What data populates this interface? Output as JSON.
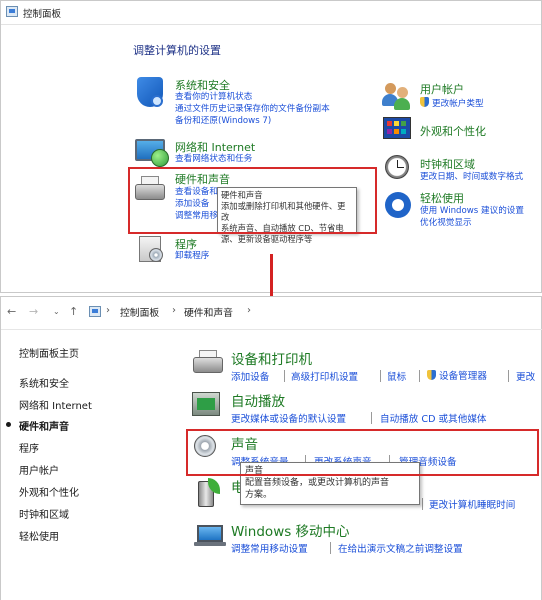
{
  "top": {
    "address": "控制面板",
    "adjust_title": "调整计算机的设置",
    "categories": {
      "security": {
        "title": "系统和安全",
        "links": [
          "查看你的计算机状态",
          "通过文件历史记录保存你的文件备份副本",
          "备份和还原(Windows 7)"
        ]
      },
      "network": {
        "title": "网络和 Internet",
        "links": [
          "查看网络状态和任务"
        ]
      },
      "hardware": {
        "title": "硬件和声音",
        "links": [
          "查看设备和",
          "添加设备",
          "调整常用移"
        ]
      },
      "programs": {
        "title": "程序",
        "links": [
          "卸载程序"
        ]
      },
      "accounts": {
        "title": "用户帐户",
        "links": [
          "更改帐户类型"
        ]
      },
      "appearance": {
        "title": "外观和个性化",
        "links": []
      },
      "clock": {
        "title": "时钟和区域",
        "links": [
          "更改日期、时间或数字格式"
        ]
      },
      "ease": {
        "title": "轻松使用",
        "links": [
          "使用 Windows 建议的设置",
          "优化视觉显示"
        ]
      }
    },
    "tooltip": {
      "title": "硬件和声音",
      "lines": [
        "添加或删除打印机和其他硬件、更改",
        "系统声音、自动播放 CD、节省电",
        "源、更新设备驱动程序等"
      ]
    }
  },
  "bottom": {
    "breadcrumb": [
      "控制面板",
      "硬件和声音"
    ],
    "sidebar": [
      {
        "label": "控制面板主页",
        "active": false
      },
      {
        "label": "系统和安全",
        "active": false
      },
      {
        "label": "网络和 Internet",
        "active": false
      },
      {
        "label": "硬件和声音",
        "active": true
      },
      {
        "label": "程序",
        "active": false
      },
      {
        "label": "用户帐户",
        "active": false
      },
      {
        "label": "外观和个性化",
        "active": false
      },
      {
        "label": "时钟和区域",
        "active": false
      },
      {
        "label": "轻松使用",
        "active": false
      }
    ],
    "sections": {
      "devices": {
        "title": "设备和打印机",
        "links": [
          "添加设备",
          "高级打印机设置",
          "鼠标",
          "设备管理器",
          "更改"
        ]
      },
      "autoplay": {
        "title": "自动播放",
        "links": [
          "更改媒体或设备的默认设置",
          "自动播放 CD 或其他媒体"
        ]
      },
      "sound": {
        "title": "声音",
        "links": [
          "调整系统音量",
          "更改系统声音",
          "管理音频设备"
        ]
      },
      "power": {
        "title": "电",
        "links": [
          "更改计算机睡眠时间"
        ]
      },
      "mobility": {
        "title": "Windows 移动中心",
        "links": [
          "调整常用移动设置",
          "在给出演示文稿之前调整设置"
        ]
      }
    },
    "tooltip": {
      "title": "声音",
      "lines": [
        "配置音频设备，或更改计算机的声音",
        "方案。"
      ]
    }
  },
  "colors": {
    "highlight_red": "#d62a2a",
    "category_green": "#1e7a24",
    "link_blue": "#1b4fd8"
  }
}
